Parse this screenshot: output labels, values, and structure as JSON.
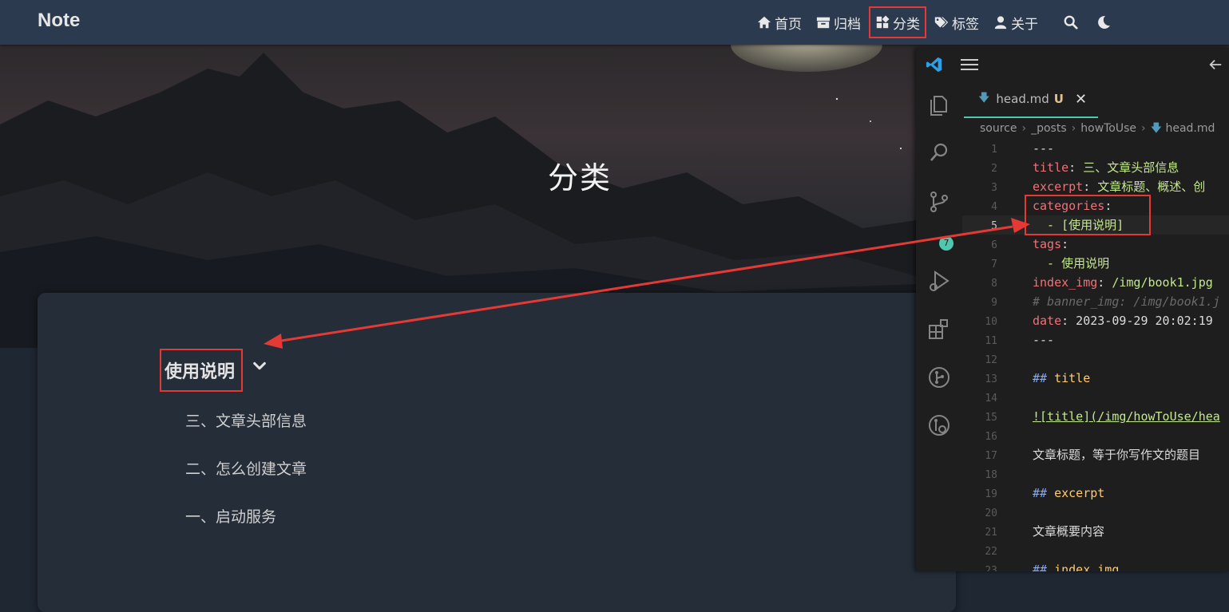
{
  "nav": {
    "brand": "Note",
    "items": [
      {
        "label": "首页",
        "icon": "home-icon"
      },
      {
        "label": "归档",
        "icon": "archive-icon"
      },
      {
        "label": "分类",
        "icon": "category-icon",
        "active": true
      },
      {
        "label": "标签",
        "icon": "tags-icon"
      },
      {
        "label": "关于",
        "icon": "user-icon"
      }
    ],
    "search_icon": "search-icon",
    "theme_icon": "moon-icon"
  },
  "banner": {
    "title": "分类"
  },
  "category": {
    "name": "使用说明",
    "posts": [
      "三、文章头部信息",
      "二、怎么创建文章",
      "一、启动服务"
    ]
  },
  "vscode": {
    "tab": {
      "filename": "head.md",
      "status": "U"
    },
    "breadcrumb": [
      "source",
      "_posts",
      "howToUse",
      "head.md"
    ],
    "scm_badge": "7",
    "lines": [
      {
        "n": "1",
        "text": "---"
      },
      {
        "n": "2",
        "key": "title",
        "value": " 三、文章头部信息"
      },
      {
        "n": "3",
        "key": "excerpt",
        "value": " 文章标题、概述、创"
      },
      {
        "n": "4",
        "key": "categories",
        "value": ""
      },
      {
        "n": "5",
        "text": "  - [使用说明]"
      },
      {
        "n": "6",
        "key": "tags",
        "value": ""
      },
      {
        "n": "7",
        "text": "  - 使用说明"
      },
      {
        "n": "8",
        "key": "index_img",
        "value": " /img/book1.jpg"
      },
      {
        "n": "9",
        "comment": "# banner_img: /img/book1.j"
      },
      {
        "n": "10",
        "key": "date",
        "value": " 2023-09-29 20:02:19"
      },
      {
        "n": "11",
        "text": "---"
      },
      {
        "n": "12",
        "text": ""
      },
      {
        "n": "13",
        "hash": "## ",
        "heading": "title"
      },
      {
        "n": "14",
        "text": ""
      },
      {
        "n": "15",
        "text": "![title](/img/howToUse/hea"
      },
      {
        "n": "16",
        "text": ""
      },
      {
        "n": "17",
        "text": "文章标题，等于你写作文的题目"
      },
      {
        "n": "18",
        "text": ""
      },
      {
        "n": "19",
        "hash": "## ",
        "heading": "excerpt"
      },
      {
        "n": "20",
        "text": ""
      },
      {
        "n": "21",
        "text": "文章概要内容"
      },
      {
        "n": "22",
        "text": ""
      },
      {
        "n": "23",
        "hash": "## ",
        "heading": "index_img"
      }
    ]
  },
  "colors": {
    "highlight": "#e53935",
    "nav_bg": "#2b3a4e",
    "card_bg": "#252d38",
    "accent": "#4ec9b0"
  }
}
